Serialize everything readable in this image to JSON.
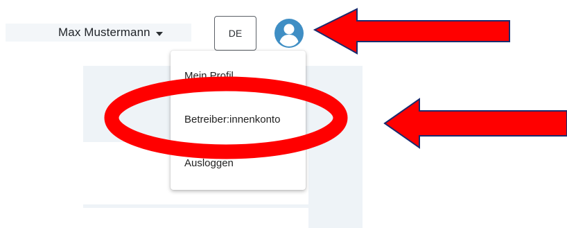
{
  "header": {
    "user_name": "Max Mustermann",
    "language": "DE"
  },
  "menu": {
    "items": [
      {
        "label": "Mein Profil"
      },
      {
        "label": "Betreiber:innenkonto"
      },
      {
        "label": "Ausloggen"
      }
    ]
  },
  "icons": {
    "dropdown_caret": "caret-down-icon",
    "avatar": "user-avatar-icon"
  },
  "colors": {
    "avatar": "#3f8ec4",
    "annotation_red": "#ff0000",
    "annotation_outline": "#1a2b6e",
    "panel_background": "#eef3f7"
  }
}
